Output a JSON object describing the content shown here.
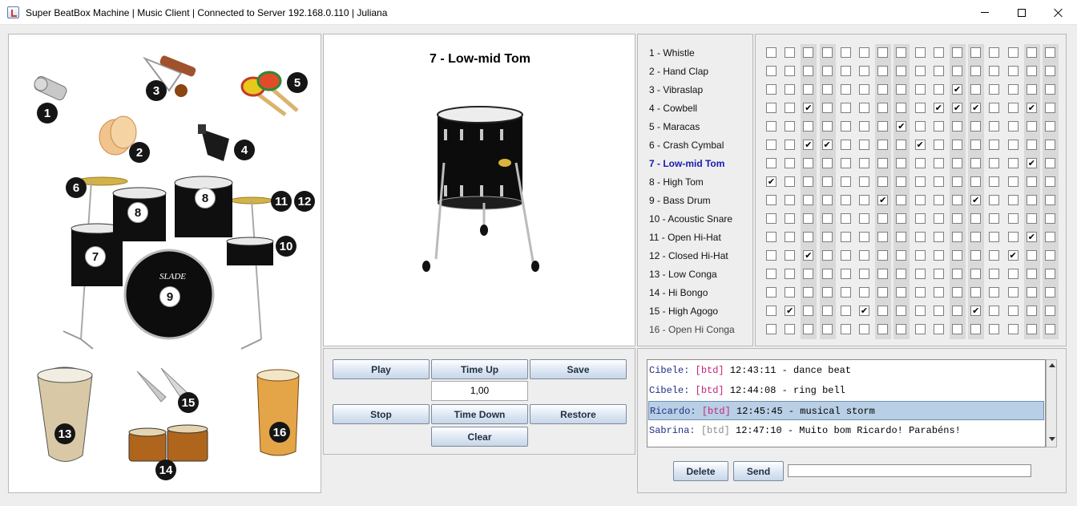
{
  "window": {
    "title": "Super BeatBox Machine | Music Client | Connected to Server 192.168.0.110 | Juliana"
  },
  "instruments_image": {
    "labels": [
      "1",
      "2",
      "3",
      "4",
      "5",
      "6",
      "7",
      "8",
      "8",
      "9",
      "10",
      "11",
      "12",
      "13",
      "14",
      "15",
      "16"
    ],
    "brand": "SLADE"
  },
  "preview": {
    "title": "7 - Low-mid Tom"
  },
  "controls": {
    "play": "Play",
    "time_up": "Time Up",
    "save": "Save",
    "tempo": "1,00",
    "stop": "Stop",
    "time_down": "Time Down",
    "restore": "Restore",
    "clear": "Clear"
  },
  "instruments": [
    "1 - Whistle",
    "2 - Hand Clap",
    "3 - Vibraslap",
    "4 - Cowbell",
    "5 - Maracas",
    "6 - Crash Cymbal",
    "7 - Low-mid Tom",
    "8 - High Tom",
    "9 - Bass Drum",
    "10 - Acoustic Snare",
    "11 - Open Hi-Hat",
    "12 - Closed Hi-Hat",
    "13 - Low Conga",
    "14 - Hi Bongo",
    "15 - High Agogo",
    "16 - Open Hi Conga"
  ],
  "selected_instrument_index": 6,
  "pattern": [
    [
      0,
      0,
      0,
      0,
      0,
      0,
      0,
      0,
      0,
      0,
      0,
      0,
      0,
      0,
      0,
      0
    ],
    [
      0,
      0,
      0,
      0,
      0,
      0,
      0,
      0,
      0,
      0,
      0,
      0,
      0,
      0,
      0,
      0
    ],
    [
      0,
      0,
      0,
      0,
      0,
      0,
      0,
      0,
      0,
      0,
      1,
      0,
      0,
      0,
      0,
      0
    ],
    [
      0,
      0,
      1,
      0,
      0,
      0,
      0,
      0,
      0,
      1,
      1,
      1,
      0,
      0,
      1,
      0
    ],
    [
      0,
      0,
      0,
      0,
      0,
      0,
      0,
      1,
      0,
      0,
      0,
      0,
      0,
      0,
      0,
      0
    ],
    [
      0,
      0,
      1,
      1,
      0,
      0,
      0,
      0,
      1,
      0,
      0,
      0,
      0,
      0,
      0,
      0
    ],
    [
      0,
      0,
      0,
      0,
      0,
      0,
      0,
      0,
      0,
      0,
      0,
      0,
      0,
      0,
      1,
      0
    ],
    [
      1,
      0,
      0,
      0,
      0,
      0,
      0,
      0,
      0,
      0,
      0,
      0,
      0,
      0,
      0,
      0
    ],
    [
      0,
      0,
      0,
      0,
      0,
      0,
      1,
      0,
      0,
      0,
      0,
      1,
      0,
      0,
      0,
      0
    ],
    [
      0,
      0,
      0,
      0,
      0,
      0,
      0,
      0,
      0,
      0,
      0,
      0,
      0,
      0,
      0,
      0
    ],
    [
      0,
      0,
      0,
      0,
      0,
      0,
      0,
      0,
      0,
      0,
      0,
      0,
      0,
      0,
      1,
      0
    ],
    [
      0,
      0,
      1,
      0,
      0,
      0,
      0,
      0,
      0,
      0,
      0,
      0,
      0,
      1,
      0,
      0
    ],
    [
      0,
      0,
      0,
      0,
      0,
      0,
      0,
      0,
      0,
      0,
      0,
      0,
      0,
      0,
      0,
      0
    ],
    [
      0,
      0,
      0,
      0,
      0,
      0,
      0,
      0,
      0,
      0,
      0,
      0,
      0,
      0,
      0,
      0
    ],
    [
      0,
      1,
      0,
      0,
      0,
      1,
      0,
      0,
      0,
      0,
      0,
      1,
      0,
      0,
      0,
      0
    ],
    [
      0,
      0,
      0,
      0,
      0,
      0,
      0,
      0,
      0,
      0,
      0,
      0,
      0,
      0,
      0,
      0
    ]
  ],
  "chat": {
    "messages": [
      {
        "user": "Cibele:",
        "tag": "[btd]",
        "time": "12:43:11",
        "text": "- dance beat",
        "tag_color": "pink",
        "selected": false
      },
      {
        "user": "Cibele:",
        "tag": "[btd]",
        "time": "12:44:08",
        "text": "- ring bell",
        "tag_color": "pink",
        "selected": false
      },
      {
        "user": "Ricardo:",
        "tag": "[btd]",
        "time": "12:45:45",
        "text": "- musical storm",
        "tag_color": "pink",
        "selected": true
      },
      {
        "user": "Sabrina:",
        "tag": "[btd]",
        "time": "12:47:10",
        "text": "- Muito bom Ricardo! Parabéns!",
        "tag_color": "gray",
        "selected": false
      }
    ],
    "delete": "Delete",
    "send": "Send",
    "input_value": ""
  }
}
